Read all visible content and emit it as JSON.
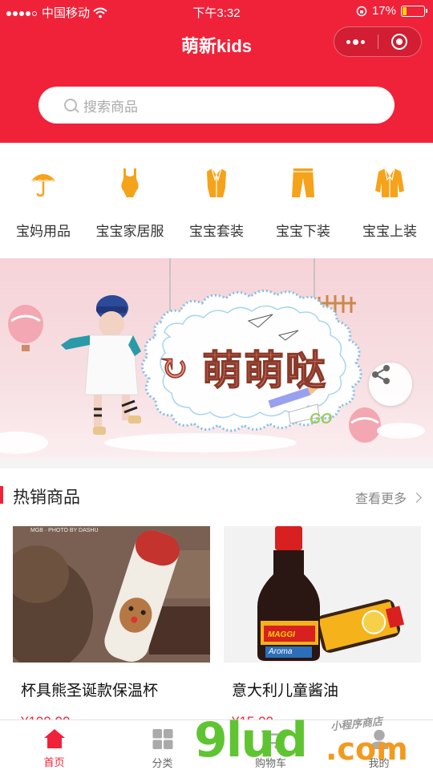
{
  "status_bar": {
    "carrier": "中国移动",
    "time": "下午3:32",
    "battery_percent": "17%",
    "battery_level": 0.17
  },
  "navbar": {
    "title": "萌新kids"
  },
  "search": {
    "placeholder": "搜索商品"
  },
  "categories": [
    {
      "label": "宝妈用品",
      "icon": "umbrella-icon"
    },
    {
      "label": "宝宝家居服",
      "icon": "swimsuit-icon"
    },
    {
      "label": "宝宝套装",
      "icon": "suit-icon"
    },
    {
      "label": "宝宝下装",
      "icon": "pants-icon"
    },
    {
      "label": "宝宝上装",
      "icon": "jacket-icon"
    }
  ],
  "banner": {
    "text": "萌萌哒",
    "logo_text": "GO"
  },
  "hot_section": {
    "title": "热销商品",
    "more_label": "查看更多"
  },
  "products": [
    {
      "name": "杯具熊圣诞款保温杯",
      "price": "¥199.00",
      "photo_credit": "MGB · PHOTO BY DASHU"
    },
    {
      "name": "意大利儿童酱油",
      "price": "¥15.00",
      "bottle_brand": "MAGGI",
      "bottle_label": "Aroma"
    }
  ],
  "tabbar": [
    {
      "label": "首页",
      "icon": "home-icon",
      "active": true
    },
    {
      "label": "分类",
      "icon": "grid-icon",
      "active": false
    },
    {
      "label": "购物车",
      "icon": "cart-icon",
      "active": false
    },
    {
      "label": "我的",
      "icon": "user-icon",
      "active": false
    }
  ],
  "watermark": {
    "brand": "9lud",
    "suffix": ".com",
    "tagline": "小程序商店"
  },
  "colors": {
    "brand_red": "#f0223a",
    "icon_orange": "#f5a31a"
  }
}
